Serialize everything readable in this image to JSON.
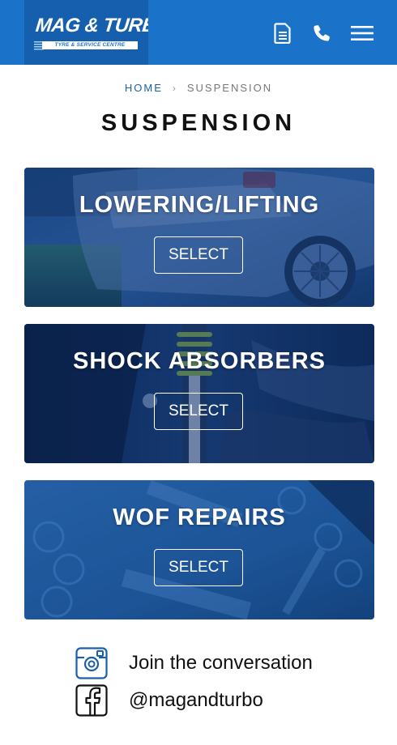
{
  "header": {
    "logo_main": "MAG & TURBO",
    "logo_sub": "TYRE & SERVICE CENTRE",
    "icons": [
      "document-icon",
      "phone-icon",
      "menu-icon"
    ],
    "colors": {
      "bar": "#1a73c9",
      "logo_bg": "#155fae"
    }
  },
  "breadcrumb": {
    "home": "HOME",
    "separator": "›",
    "current": "SUSPENSION"
  },
  "page_title": "SUSPENSION",
  "cards": [
    {
      "title": "LOWERING/LIFTING",
      "button": "SELECT",
      "image": "car-rear-wheel-photo"
    },
    {
      "title": "SHOCK ABSORBERS",
      "button": "SELECT",
      "image": "coilover-suspension-photo"
    },
    {
      "title": "WOF REPAIRS",
      "button": "SELECT",
      "image": "warrant-of-fitness-sticker-photo"
    }
  ],
  "social": {
    "instagram_text": "Join the conversation",
    "facebook_text": "@magandturbo"
  }
}
